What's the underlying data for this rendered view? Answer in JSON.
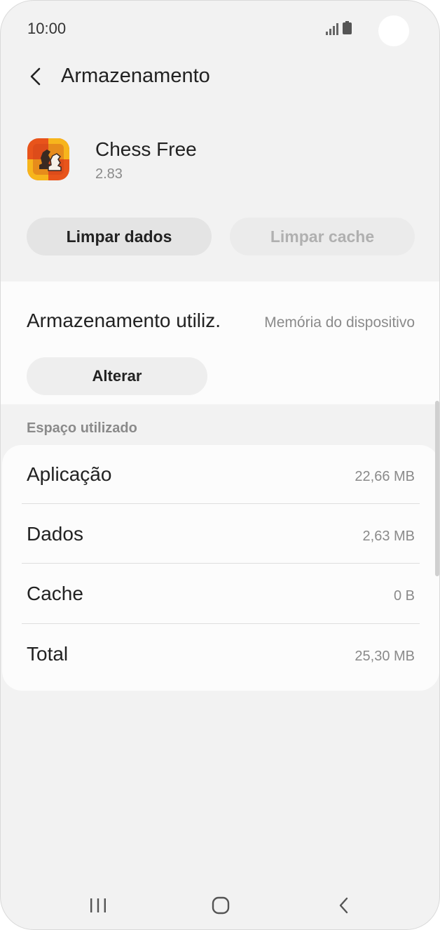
{
  "status_bar": {
    "time": "10:00"
  },
  "header": {
    "title": "Armazenamento"
  },
  "app": {
    "name": "Chess Free",
    "version": "2.83",
    "buttons": {
      "clear_data": "Limpar dados",
      "clear_cache": "Limpar cache"
    }
  },
  "storage": {
    "label": "Armazenamento utiliz.",
    "location": "Memória do dispositivo",
    "change_button": "Alterar"
  },
  "space_used": {
    "header": "Espaço utilizado",
    "rows": [
      {
        "label": "Aplicação",
        "value": "22,66 MB"
      },
      {
        "label": "Dados",
        "value": "2,63 MB"
      },
      {
        "label": "Cache",
        "value": "0 B"
      },
      {
        "label": "Total",
        "value": "25,30 MB"
      }
    ]
  },
  "colors": {
    "background": "#f2f2f2",
    "card": "#fcfcfc",
    "primary_text": "#222222",
    "secondary_text": "#8a8a8a",
    "disabled_text": "#b0b0b0"
  },
  "icons": {
    "back": "chevron-left-icon",
    "app": "chess-app-icon",
    "nav_recents": "recents-icon",
    "nav_home": "home-icon",
    "nav_back": "back-icon"
  }
}
